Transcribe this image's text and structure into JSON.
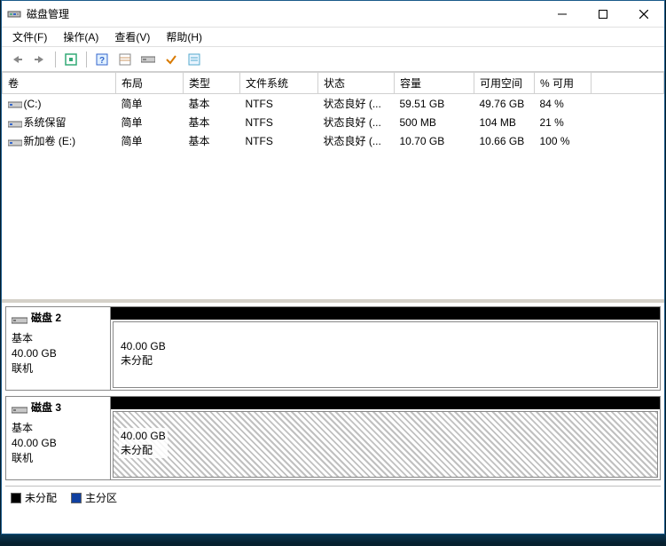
{
  "window": {
    "title": "磁盘管理"
  },
  "menubar": {
    "file": "文件(F)",
    "action": "操作(A)",
    "view": "查看(V)",
    "help": "帮助(H)"
  },
  "columns": {
    "volume": "卷",
    "layout": "布局",
    "type": "类型",
    "filesystem": "文件系统",
    "status": "状态",
    "capacity": "容量",
    "free": "可用空间",
    "pctfree": "% 可用"
  },
  "volumes": [
    {
      "name": "(C:)",
      "layout": "简单",
      "type": "基本",
      "fs": "NTFS",
      "status": "状态良好 (...",
      "capacity": "59.51 GB",
      "free": "49.76 GB",
      "pct": "84 %"
    },
    {
      "name": "系统保留",
      "layout": "简单",
      "type": "基本",
      "fs": "NTFS",
      "status": "状态良好 (...",
      "capacity": "500 MB",
      "free": "104 MB",
      "pct": "21 %"
    },
    {
      "name": "新加卷 (E:)",
      "layout": "简单",
      "type": "基本",
      "fs": "NTFS",
      "status": "状态良好 (...",
      "capacity": "10.70 GB",
      "free": "10.66 GB",
      "pct": "100 %"
    }
  ],
  "disks": [
    {
      "title": "磁盘 2",
      "type": "基本",
      "size": "40.00 GB",
      "status": "联机",
      "part_size": "40.00 GB",
      "part_status": "未分配",
      "hatched": false
    },
    {
      "title": "磁盘 3",
      "type": "基本",
      "size": "40.00 GB",
      "status": "联机",
      "part_size": "40.00 GB",
      "part_status": "未分配",
      "hatched": true
    }
  ],
  "legend": {
    "unallocated": "未分配",
    "primary": "主分区"
  },
  "colors": {
    "unallocated": "#000000",
    "primary": "#1040a0"
  }
}
